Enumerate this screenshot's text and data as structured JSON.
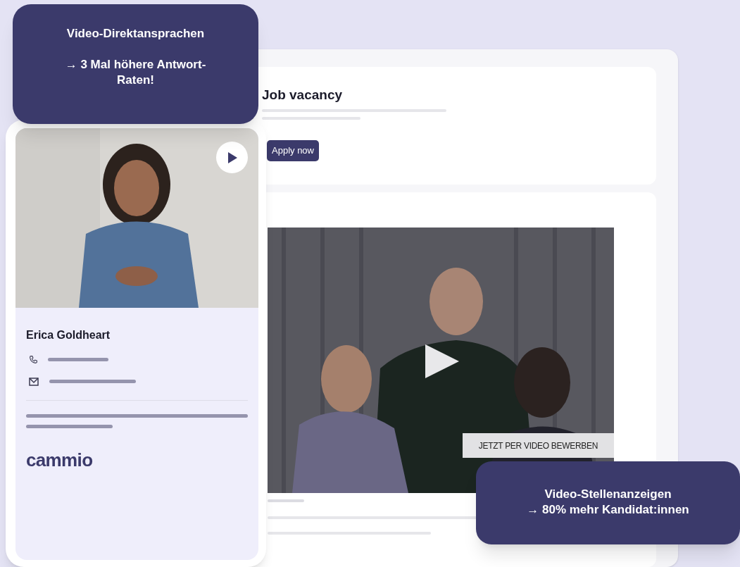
{
  "job_card": {
    "title": "Job vacancy",
    "button": "Apply now"
  },
  "video_card": {
    "overlay_label": "JETZT PER VIDEO BEWERBEN"
  },
  "profile_card": {
    "name": "Erica Goldheart",
    "logo": "cammio"
  },
  "callouts": [
    {
      "title": "Video-Direktansprachen",
      "subtitle": "→ 3 Mal höhere Antwort-Raten!"
    },
    {
      "title": "Video-Stellenanzeigen",
      "subtitle": "→ 80% mehr Kandidat:innen"
    }
  ]
}
